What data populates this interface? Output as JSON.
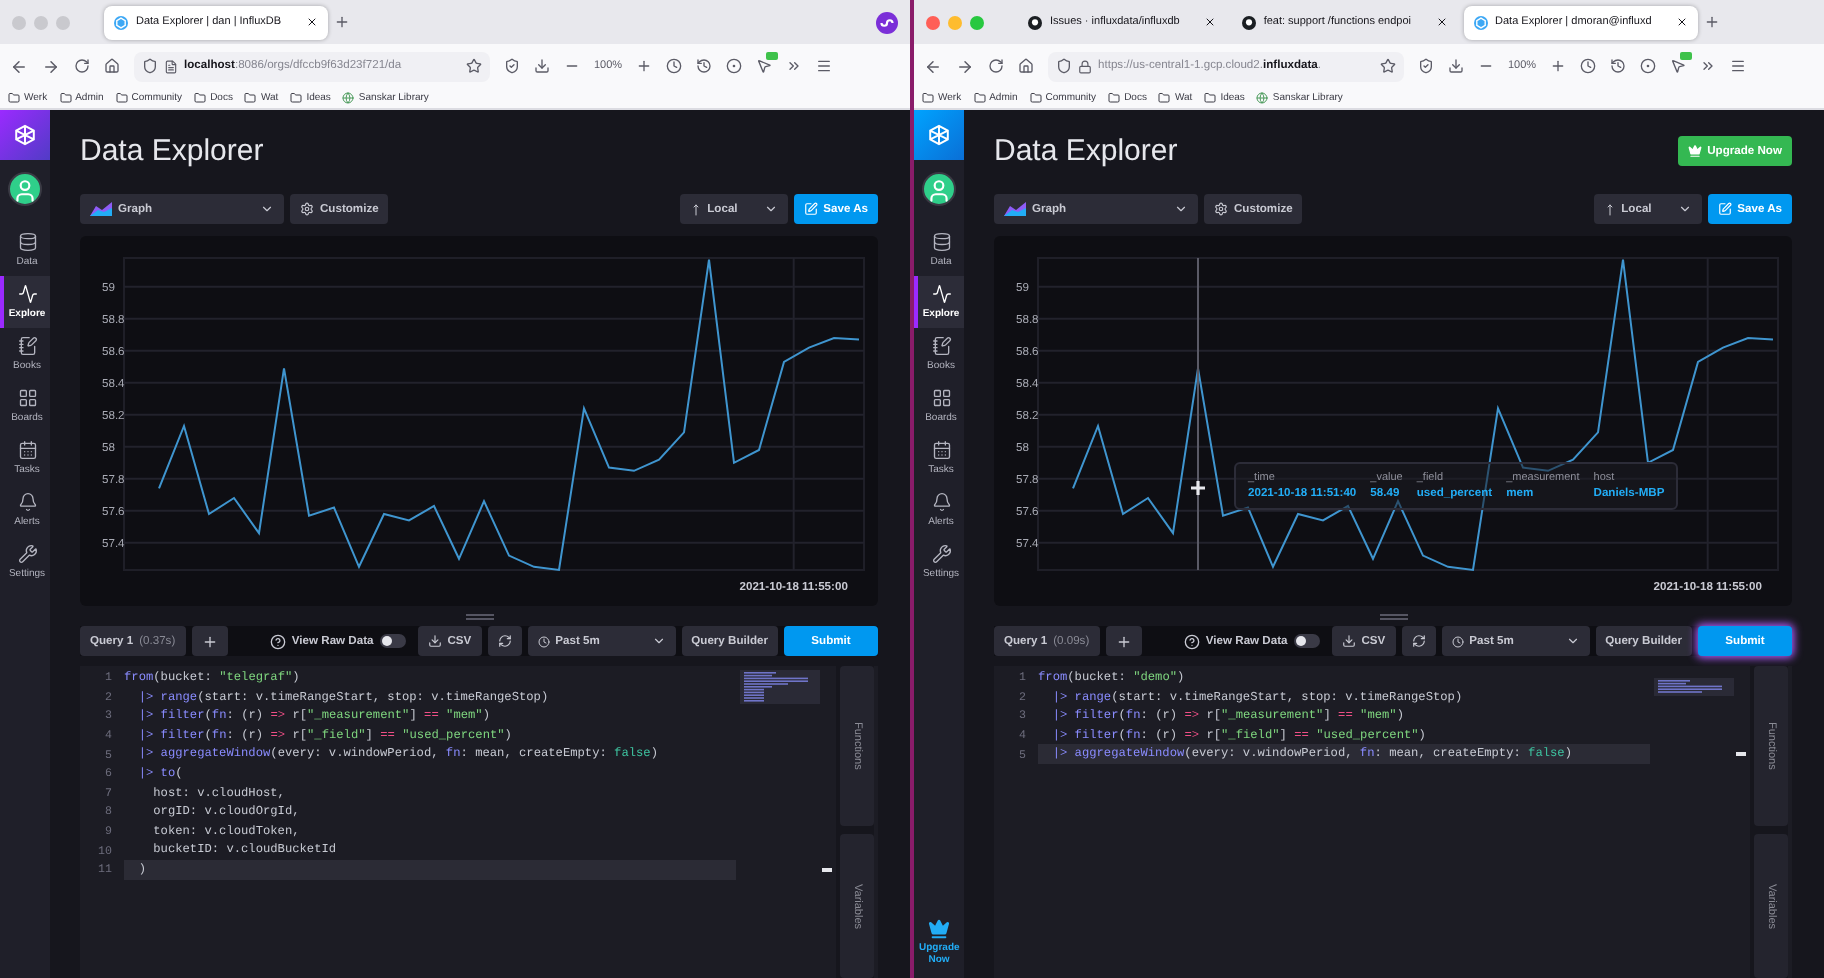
{
  "browsers": [
    {
      "focused": false,
      "account_icon": true,
      "tabs": [
        {
          "kind": "influx",
          "title": "Data Explorer | dan | InfluxDB",
          "selected": true
        }
      ],
      "url": {
        "secure": false,
        "text": "**localhost**:8086/orgs/dfccb9f63d23f721/da"
      },
      "zoom_level": "100%",
      "bookmarks": [
        {
          "kind": "folder",
          "label": "Werk"
        },
        {
          "kind": "folder",
          "label": "Admin"
        },
        {
          "kind": "folder",
          "label": "Community"
        },
        {
          "kind": "folder",
          "label": "Docs"
        },
        {
          "kind": "folder",
          "label": "Wat"
        },
        {
          "kind": "folder",
          "label": "Ideas"
        },
        {
          "kind": "page",
          "label": "Sanskar Library"
        }
      ],
      "app": {
        "nav": [
          {
            "label": "Data",
            "selected": false
          },
          {
            "label": "Explore",
            "selected": true
          },
          {
            "label": "Books",
            "selected": false
          },
          {
            "label": "Boards",
            "selected": false
          },
          {
            "label": "Tasks",
            "selected": false
          },
          {
            "label": "Alerts",
            "selected": false
          },
          {
            "label": "Settings",
            "selected": false
          }
        ],
        "title": "Data Explorer",
        "toolbar": {
          "view": "Graph",
          "customize": "Customize",
          "timezone": "Local",
          "save": "Save As"
        },
        "chart": {
          "chart_data": {
            "type": "line",
            "grid": true,
            "series": [
              {
                "color": "#3f95cf",
                "values": [
                  57.74,
                  58.13,
                  57.58,
                  57.68,
                  57.46,
                  58.49,
                  57.57,
                  57.62,
                  57.25,
                  57.58,
                  57.54,
                  57.63,
                  57.3,
                  57.66,
                  57.32,
                  57.25,
                  57.23,
                  58.24,
                  57.87,
                  57.85,
                  57.92,
                  58.09,
                  59.17,
                  57.9,
                  57.98,
                  58.53,
                  58.62,
                  58.68,
                  58.67
                ]
              }
            ],
            "ylim": [
              57.23,
              59.18
            ],
            "yticks": [
              {
                "value": 57.4,
                "label": "57.4"
              },
              {
                "value": 57.6,
                "label": "57.6"
              },
              {
                "value": 57.8,
                "label": "57.8"
              },
              {
                "value": 58,
                "label": "58"
              },
              {
                "value": 58.2,
                "label": "58.2"
              },
              {
                "value": 58.4,
                "label": "58.4"
              },
              {
                "value": 58.6,
                "label": "58.6"
              },
              {
                "value": 58.8,
                "label": "58.8"
              },
              {
                "value": 59,
                "label": "59"
              }
            ],
            "annotations": [
              "2021-10-18 11:55:00"
            ]
          }
        },
        "query": {
          "label": "Query 1",
          "timing": "(0.37s)",
          "raw_data": {
            "label": "View Raw Data",
            "on": false
          },
          "csv": "CSV",
          "range": "Past 5m",
          "builder": "Query Builder",
          "submit": {
            "label": "Submit",
            "highlighted": false
          }
        },
        "code": [
          {
            "number": "1",
            "current": false,
            "segments": [
              {
                "kind": "kw",
                "text": "from"
              },
              {
                "kind": "plain",
                "text": "(bucket: "
              },
              {
                "kind": "str",
                "text": "\"telegraf\""
              },
              {
                "kind": "plain",
                "text": ")"
              }
            ]
          },
          {
            "number": "2",
            "current": false,
            "segments": [
              {
                "kind": "pipe",
                "text": "  |> "
              },
              {
                "kind": "kw",
                "text": "range"
              },
              {
                "kind": "plain",
                "text": "(start: v.timeRangeStart, stop: v.timeRangeStop)"
              }
            ]
          },
          {
            "number": "3",
            "current": false,
            "segments": [
              {
                "kind": "pipe",
                "text": "  |> "
              },
              {
                "kind": "kw",
                "text": "filter"
              },
              {
                "kind": "plain",
                "text": "("
              },
              {
                "kind": "kw",
                "text": "fn"
              },
              {
                "kind": "plain",
                "text": ": (r) "
              },
              {
                "kind": "op",
                "text": "=>"
              },
              {
                "kind": "plain",
                "text": " r["
              },
              {
                "kind": "str",
                "text": "\"_measurement\""
              },
              {
                "kind": "plain",
                "text": "] "
              },
              {
                "kind": "op",
                "text": "=="
              },
              {
                "kind": "str",
                "text": " \"mem\""
              },
              {
                "kind": "plain",
                "text": ")"
              }
            ]
          },
          {
            "number": "4",
            "current": false,
            "segments": [
              {
                "kind": "pipe",
                "text": "  |> "
              },
              {
                "kind": "kw",
                "text": "filter"
              },
              {
                "kind": "plain",
                "text": "("
              },
              {
                "kind": "kw",
                "text": "fn"
              },
              {
                "kind": "plain",
                "text": ": (r) "
              },
              {
                "kind": "op",
                "text": "=>"
              },
              {
                "kind": "plain",
                "text": " r["
              },
              {
                "kind": "str",
                "text": "\"_field\""
              },
              {
                "kind": "plain",
                "text": "] "
              },
              {
                "kind": "op",
                "text": "=="
              },
              {
                "kind": "str",
                "text": " \"used_percent\""
              },
              {
                "kind": "plain",
                "text": ")"
              }
            ]
          },
          {
            "number": "5",
            "current": false,
            "segments": [
              {
                "kind": "pipe",
                "text": "  |> "
              },
              {
                "kind": "kw",
                "text": "aggregateWindow"
              },
              {
                "kind": "plain",
                "text": "(every: v.windowPeriod, "
              },
              {
                "kind": "kw",
                "text": "fn"
              },
              {
                "kind": "plain",
                "text": ": mean, createEmpty: "
              },
              {
                "kind": "bool",
                "text": "false"
              },
              {
                "kind": "plain",
                "text": ")"
              }
            ]
          },
          {
            "number": "6",
            "current": false,
            "segments": [
              {
                "kind": "pipe",
                "text": "  |> "
              },
              {
                "kind": "kw",
                "text": "to"
              },
              {
                "kind": "plain",
                "text": "("
              }
            ]
          },
          {
            "number": "7",
            "current": false,
            "segments": [
              {
                "kind": "plain",
                "text": "    host: v.cloudHost,"
              }
            ]
          },
          {
            "number": "8",
            "current": false,
            "segments": [
              {
                "kind": "plain",
                "text": "    orgID: v.cloudOrgId,"
              }
            ]
          },
          {
            "number": "9",
            "current": false,
            "segments": [
              {
                "kind": "plain",
                "text": "    token: v.cloudToken,"
              }
            ]
          },
          {
            "number": "10",
            "current": false,
            "segments": [
              {
                "kind": "plain",
                "text": "    bucketID: v.cloudBucketId"
              }
            ]
          },
          {
            "number": "11",
            "current": true,
            "segments": [
              {
                "kind": "plain",
                "text": "  )"
              }
            ]
          }
        ],
        "side_tabs": [
          "Functions",
          "Variables"
        ]
      }
    },
    {
      "focused": true,
      "account_icon": false,
      "tabs": [
        {
          "kind": "github",
          "title": "Issues · influxdata/influxdb",
          "selected": false
        },
        {
          "kind": "github",
          "title": "feat: support /functions endpoi",
          "selected": false
        },
        {
          "kind": "influx",
          "title": "Data Explorer | dmoran@influxd",
          "selected": true
        }
      ],
      "url": {
        "secure": true,
        "text": "https://us-central1-1.gcp.cloud2.**influxdata**."
      },
      "zoom_level": "100%",
      "bookmarks": [
        {
          "kind": "folder",
          "label": "Werk"
        },
        {
          "kind": "folder",
          "label": "Admin"
        },
        {
          "kind": "folder",
          "label": "Community"
        },
        {
          "kind": "folder",
          "label": "Docs"
        },
        {
          "kind": "folder",
          "label": "Wat"
        },
        {
          "kind": "folder",
          "label": "Ideas"
        },
        {
          "kind": "page",
          "label": "Sanskar Library"
        }
      ],
      "app": {
        "nav": [
          {
            "label": "Data",
            "selected": false
          },
          {
            "label": "Explore",
            "selected": true
          },
          {
            "label": "Books",
            "selected": false
          },
          {
            "label": "Boards",
            "selected": false
          },
          {
            "label": "Tasks",
            "selected": false
          },
          {
            "label": "Alerts",
            "selected": false
          },
          {
            "label": "Settings",
            "selected": false
          }
        ],
        "sidebar_upgrade": "Upgrade Now",
        "title": "Data Explorer",
        "upgrade": "Upgrade Now",
        "toolbar": {
          "view": "Graph",
          "customize": "Customize",
          "timezone": "Local",
          "save": "Save As"
        },
        "chart": {
          "chart_data": {
            "type": "line",
            "grid": true,
            "series": [
              {
                "color": "#3f95cf",
                "values": [
                  57.74,
                  58.13,
                  57.58,
                  57.68,
                  57.46,
                  58.49,
                  57.57,
                  57.62,
                  57.25,
                  57.58,
                  57.54,
                  57.63,
                  57.3,
                  57.66,
                  57.32,
                  57.25,
                  57.23,
                  58.24,
                  57.87,
                  57.85,
                  57.92,
                  58.09,
                  59.17,
                  57.9,
                  57.98,
                  58.53,
                  58.62,
                  58.68,
                  58.67
                ]
              }
            ],
            "ylim": [
              57.23,
              59.18
            ],
            "yticks": [
              {
                "value": 57.4,
                "label": "57.4"
              },
              {
                "value": 57.6,
                "label": "57.6"
              },
              {
                "value": 57.8,
                "label": "57.8"
              },
              {
                "value": 58,
                "label": "58"
              },
              {
                "value": 58.2,
                "label": "58.2"
              },
              {
                "value": 58.4,
                "label": "58.4"
              },
              {
                "value": 58.6,
                "label": "58.6"
              },
              {
                "value": 58.8,
                "label": "58.8"
              },
              {
                "value": 59,
                "label": "59"
              }
            ],
            "annotations": [
              "2021-10-18 11:55:00"
            ]
          },
          "tooltip": [
            {
              "header": "_time",
              "value": "2021-10-18 11:51:40"
            },
            {
              "header": "_value",
              "value": "58.49"
            },
            {
              "header": "_field",
              "value": "used_percent"
            },
            {
              "header": "_measurement",
              "value": "mem"
            },
            {
              "header": "host",
              "value": "Daniels-MBP"
            }
          ]
        },
        "query": {
          "label": "Query 1",
          "timing": "(0.09s)",
          "raw_data": {
            "label": "View Raw Data",
            "on": false
          },
          "csv": "CSV",
          "range": "Past 5m",
          "builder": "Query Builder",
          "submit": {
            "label": "Submit",
            "highlighted": true
          }
        },
        "code": [
          {
            "number": "1",
            "current": false,
            "segments": [
              {
                "kind": "kw",
                "text": "from"
              },
              {
                "kind": "plain",
                "text": "(bucket: "
              },
              {
                "kind": "str",
                "text": "\"demo\""
              },
              {
                "kind": "plain",
                "text": ")"
              }
            ]
          },
          {
            "number": "2",
            "current": false,
            "segments": [
              {
                "kind": "pipe",
                "text": "  |> "
              },
              {
                "kind": "kw",
                "text": "range"
              },
              {
                "kind": "plain",
                "text": "(start: v.timeRangeStart, stop: v.timeRangeStop)"
              }
            ]
          },
          {
            "number": "3",
            "current": false,
            "segments": [
              {
                "kind": "pipe",
                "text": "  |> "
              },
              {
                "kind": "kw",
                "text": "filter"
              },
              {
                "kind": "plain",
                "text": "("
              },
              {
                "kind": "kw",
                "text": "fn"
              },
              {
                "kind": "plain",
                "text": ": (r) "
              },
              {
                "kind": "op",
                "text": "=>"
              },
              {
                "kind": "plain",
                "text": " r["
              },
              {
                "kind": "str",
                "text": "\"_measurement\""
              },
              {
                "kind": "plain",
                "text": "] "
              },
              {
                "kind": "op",
                "text": "=="
              },
              {
                "kind": "str",
                "text": " \"mem\""
              },
              {
                "kind": "plain",
                "text": ")"
              }
            ]
          },
          {
            "number": "4",
            "current": false,
            "segments": [
              {
                "kind": "pipe",
                "text": "  |> "
              },
              {
                "kind": "kw",
                "text": "filter"
              },
              {
                "kind": "plain",
                "text": "("
              },
              {
                "kind": "kw",
                "text": "fn"
              },
              {
                "kind": "plain",
                "text": ": (r) "
              },
              {
                "kind": "op",
                "text": "=>"
              },
              {
                "kind": "plain",
                "text": " r["
              },
              {
                "kind": "str",
                "text": "\"_field\""
              },
              {
                "kind": "plain",
                "text": "] "
              },
              {
                "kind": "op",
                "text": "=="
              },
              {
                "kind": "str",
                "text": " \"used_percent\""
              },
              {
                "kind": "plain",
                "text": ")"
              }
            ]
          },
          {
            "number": "5",
            "current": true,
            "segments": [
              {
                "kind": "pipe",
                "text": "  |> "
              },
              {
                "kind": "kw",
                "text": "aggregateWindow"
              },
              {
                "kind": "plain",
                "text": "(every: v.windowPeriod, "
              },
              {
                "kind": "kw",
                "text": "fn"
              },
              {
                "kind": "plain",
                "text": ": mean, createEmpty: "
              },
              {
                "kind": "bool",
                "text": "false"
              },
              {
                "kind": "plain",
                "text": ")"
              }
            ]
          }
        ],
        "side_tabs": [
          "Functions",
          "Variables"
        ]
      }
    }
  ]
}
